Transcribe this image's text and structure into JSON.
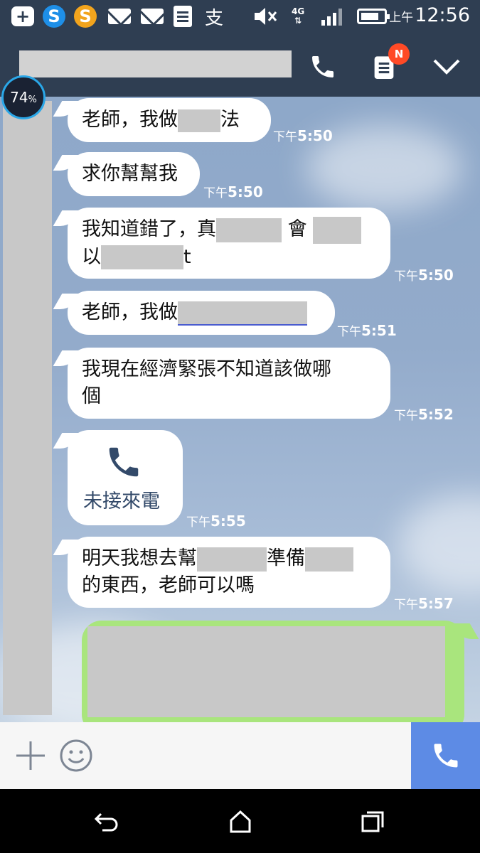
{
  "status_bar": {
    "time_prefix": "上午",
    "time": "12:56",
    "network": "4G",
    "input_method_glyph": "支"
  },
  "header": {
    "badge": "N"
  },
  "widget": {
    "percent": "74",
    "percent_sign": "%"
  },
  "messages": [
    {
      "parts": [
        "老師，我做",
        "",
        "法"
      ],
      "time_prefix": "下午",
      "time": "5:50"
    },
    {
      "parts": [
        "求你幫幫我"
      ],
      "time_prefix": "下午",
      "time": "5:50"
    },
    {
      "line1": [
        "我知道錯了，真",
        "",
        " 會",
        ""
      ],
      "line2": [
        "以",
        "",
        "t"
      ],
      "time_prefix": "下午",
      "time": "5:50"
    },
    {
      "parts": [
        "老師，我做",
        ""
      ],
      "time_prefix": "下午",
      "time": "5:51"
    },
    {
      "line1": [
        "我現在經濟緊張不知道該做哪"
      ],
      "line2": [
        "個"
      ],
      "time_prefix": "下午",
      "time": "5:52"
    },
    {
      "call_label": "未接來電",
      "time_prefix": "下午",
      "time": "5:55"
    },
    {
      "line1": [
        "明天我想去幫",
        "",
        "準備",
        ""
      ],
      "line2": [
        "的東西，老師可以嗎"
      ],
      "time_prefix": "下午",
      "time": "5:57"
    }
  ],
  "colors": {
    "header_bg": "#2f3e52",
    "badge": "#ff4a26",
    "outgoing_bubble": "#a9e57d",
    "call_button": "#5d8be5"
  },
  "icons": [
    "add-icon",
    "s-app-icon",
    "mail-icon",
    "doc-icon",
    "mute-icon",
    "signal-icon",
    "battery-icon",
    "phone-icon",
    "notes-icon",
    "chevron-down-icon",
    "plus-icon",
    "smiley-icon",
    "back-icon",
    "home-icon",
    "recents-icon"
  ]
}
